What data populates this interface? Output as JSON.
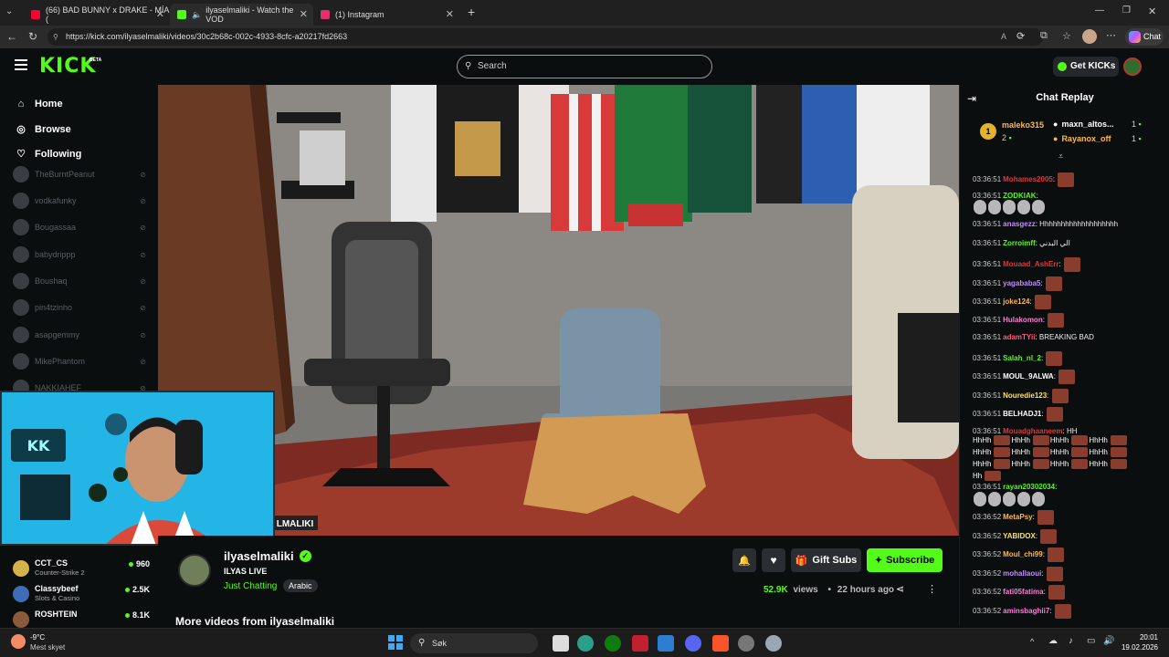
{
  "browser": {
    "tabs": [
      {
        "title": "(66) BAD BUNNY x DRAKE - MÍA (",
        "favicon_color": "#ff0033"
      },
      {
        "title": "ilyaselmaliki - Watch the VOD",
        "favicon_color": "#53fc18"
      },
      {
        "title": "(1) Instagram",
        "favicon_color": "#e1306c"
      }
    ],
    "url": "https://kick.com/ilyaselmaliki/videos/30c2b68c-002c-4933-8cfc-a20217fd2663",
    "chat_label": "Chat"
  },
  "kick": {
    "logo": "KICK",
    "beta": "BETA",
    "search_placeholder": "Search",
    "get_kicks": "Get KICKs"
  },
  "sidebar": {
    "nav": [
      {
        "label": "Home",
        "icon": "home-icon",
        "glyph": "⌂"
      },
      {
        "label": "Browse",
        "icon": "compass-icon",
        "glyph": "◎"
      },
      {
        "label": "Following",
        "icon": "heart-icon",
        "glyph": "♡"
      }
    ],
    "offline_channels": [
      "TheBurntPeanut",
      "vodkafunky",
      "Bougassaa",
      "babydrippp",
      "Boushaq",
      "pin4tzinho",
      "asapgemmy",
      "MikePhantom",
      "NAKKIAHEF"
    ],
    "live_channels": [
      {
        "name": "CCT_CS",
        "category": "Counter-Strike 2",
        "viewers": "960"
      },
      {
        "name": "Classybeef",
        "category": "Slots & Casino",
        "viewers": "2.5K"
      },
      {
        "name": "ROSHTEIN",
        "category": "",
        "viewers": "8.1K"
      }
    ]
  },
  "video": {
    "watermark": "LMALIKI"
  },
  "stream": {
    "channel": "ilyaselmaliki",
    "title": "ILYAS LIVE",
    "category": "Just Chatting",
    "tag": "Arabic",
    "gift_subs": "Gift Subs",
    "subscribe": "Subscribe",
    "views": "52.9K",
    "views_label": "views",
    "age": "22 hours ago",
    "more_videos": "More videos from ilyaselmaliki",
    "accent": "#53fc18"
  },
  "chat": {
    "title": "Chat Replay",
    "leaderboard": [
      {
        "rank": "1",
        "name": "maleko315",
        "count": "2"
      },
      {
        "name": "maxn_altos...",
        "count": "1"
      },
      {
        "name": "Rayanox_off",
        "count": "1"
      }
    ],
    "messages": [
      {
        "time": "03:36:51",
        "user": "Mohames2005",
        "color": "#e0363c",
        "text": "",
        "emotes": 1
      },
      {
        "time": "03:36:51",
        "user": "ZODKIAK",
        "color": "#53fc18",
        "text": "",
        "emotes": 0
      },
      {
        "time": "03:36:51",
        "user": "anasgezz",
        "color": "#c08bff",
        "text": "Hhhhhhhhhhhhhhhhhhh",
        "emotes": 0
      },
      {
        "time": "03:36:51",
        "user": "Zorroimff",
        "color": "#53fc18",
        "text": "الي البدني",
        "emotes": 0
      },
      {
        "time": "03:36:51",
        "user": "Mouaad_AshErr",
        "color": "#e0363c",
        "text": "",
        "emotes": 1
      },
      {
        "time": "03:36:51",
        "user": "yagababa5",
        "color": "#c08bff",
        "text": "",
        "emotes": 1
      },
      {
        "time": "03:36:51",
        "user": "joke124",
        "color": "#ffb84d",
        "text": "",
        "emotes": 1
      },
      {
        "time": "03:36:51",
        "user": "Hulakomon",
        "color": "#ff7ad9",
        "text": "",
        "emotes": 1
      },
      {
        "time": "03:36:51",
        "user": "adamTYii",
        "color": "#ff5a7a",
        "text": "BREAKING BAD",
        "emotes": 0
      },
      {
        "time": "03:36:51",
        "user": "Salah_nl_2",
        "color": "#53fc18",
        "text": "",
        "emotes": 1
      },
      {
        "time": "03:36:51",
        "user": "MOUL_9ALWA",
        "color": "#ffffff",
        "text": "",
        "emotes": 1
      },
      {
        "time": "03:36:51",
        "user": "Nouredie123",
        "color": "#ffe066",
        "text": "",
        "emotes": 1
      },
      {
        "time": "03:36:51",
        "user": "BELHADJ1",
        "color": "#ffffff",
        "text": "",
        "emotes": 1
      },
      {
        "time": "03:36:51",
        "user": "Mouadghaaneem",
        "color": "#e0363c",
        "text": "HH",
        "emotes": 0
      },
      {
        "time": "03:36:51",
        "user": "rayan20302034",
        "color": "#53fc18",
        "text": "",
        "emotes": 0
      },
      {
        "time": "03:36:52",
        "user": "MetaPsy",
        "color": "#ffb84d",
        "text": "",
        "emotes": 1
      },
      {
        "time": "03:36:52",
        "user": "YABIDOX",
        "color": "#ffe066",
        "text": "",
        "emotes": 1
      },
      {
        "time": "03:36:52",
        "user": "Moul_chi99",
        "color": "#ffb84d",
        "text": "",
        "emotes": 1
      },
      {
        "time": "03:36:52",
        "user": "mohallaoui",
        "color": "#c08bff",
        "text": "",
        "emotes": 1
      },
      {
        "time": "03:36:52",
        "user": "fati05fatima",
        "color": "#ff7ad9",
        "text": "",
        "emotes": 1
      },
      {
        "time": "03:36:52",
        "user": "aminsbaghii7",
        "color": "#ff7ad9",
        "text": "",
        "emotes": 1
      }
    ],
    "spam_rows": [
      "HhHh",
      "HhHh",
      "HhHh",
      "Hh"
    ]
  },
  "taskbar": {
    "weather_temp": "-9°C",
    "weather_desc": "Mest skyet",
    "search": "Søk",
    "time": "20:01",
    "date": "19.02.2026"
  }
}
